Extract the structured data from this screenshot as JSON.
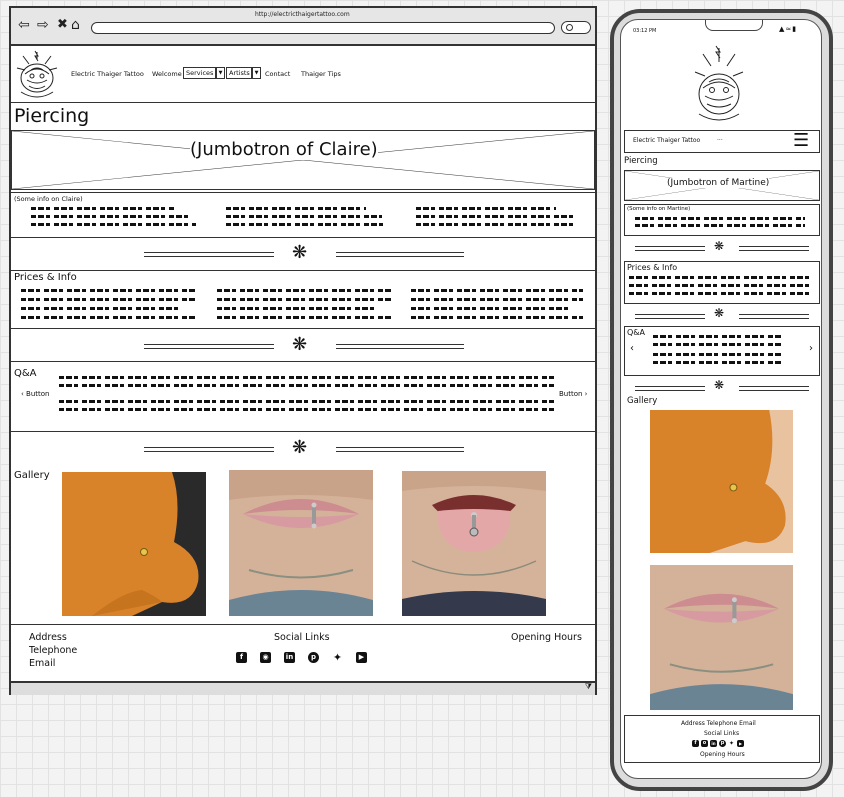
{
  "browser": {
    "url": "http://electricthaigertattoo.com",
    "nav_icons": [
      "back-arrow-icon",
      "forward-arrow-icon",
      "close-x-icon",
      "home-icon"
    ]
  },
  "site": {
    "brand": "Electric Thaiger Tattoo",
    "nav": {
      "welcome": "Welcome",
      "services": "Services",
      "artists": "Artists",
      "contact": "Contact",
      "tips": "Thaiger Tips"
    }
  },
  "page": {
    "title": "Piercing",
    "jumbotron": "(Jumbotron of Claire)",
    "info_heading": "(Some info on Claire)",
    "prices_heading": "Prices & Info",
    "qa_heading": "Q&A",
    "button_prev": "Button",
    "button_next": "Button",
    "gallery_heading": "Gallery"
  },
  "footer": {
    "address": "Address",
    "telephone": "Telephone",
    "email": "Email",
    "social_heading": "Social Links",
    "hours_heading": "Opening Hours",
    "social_icons": [
      "facebook-icon",
      "instagram-icon",
      "linkedin-icon",
      "pinterest-icon",
      "twitter-icon",
      "youtube-icon"
    ]
  },
  "mobile": {
    "time": "03:12 PM",
    "brand": "Electric Thaiger Tattoo",
    "brand_suffix": "...",
    "title": "Piercing",
    "jumbotron": "(Jumbotron of Martine)",
    "info_heading": "(Some info on Martine)",
    "prices_heading": "Prices & Info",
    "qa_heading": "Q&A",
    "gallery_heading": "Gallery",
    "footer_contact": "Address Telephone Email",
    "footer_social": "Social Links",
    "footer_hours": "Opening Hours"
  },
  "colors": {
    "skin_orange": "#d8822a",
    "skin_light": "#d9b49c",
    "lip": "#d69aa0",
    "outline": "#333333"
  }
}
